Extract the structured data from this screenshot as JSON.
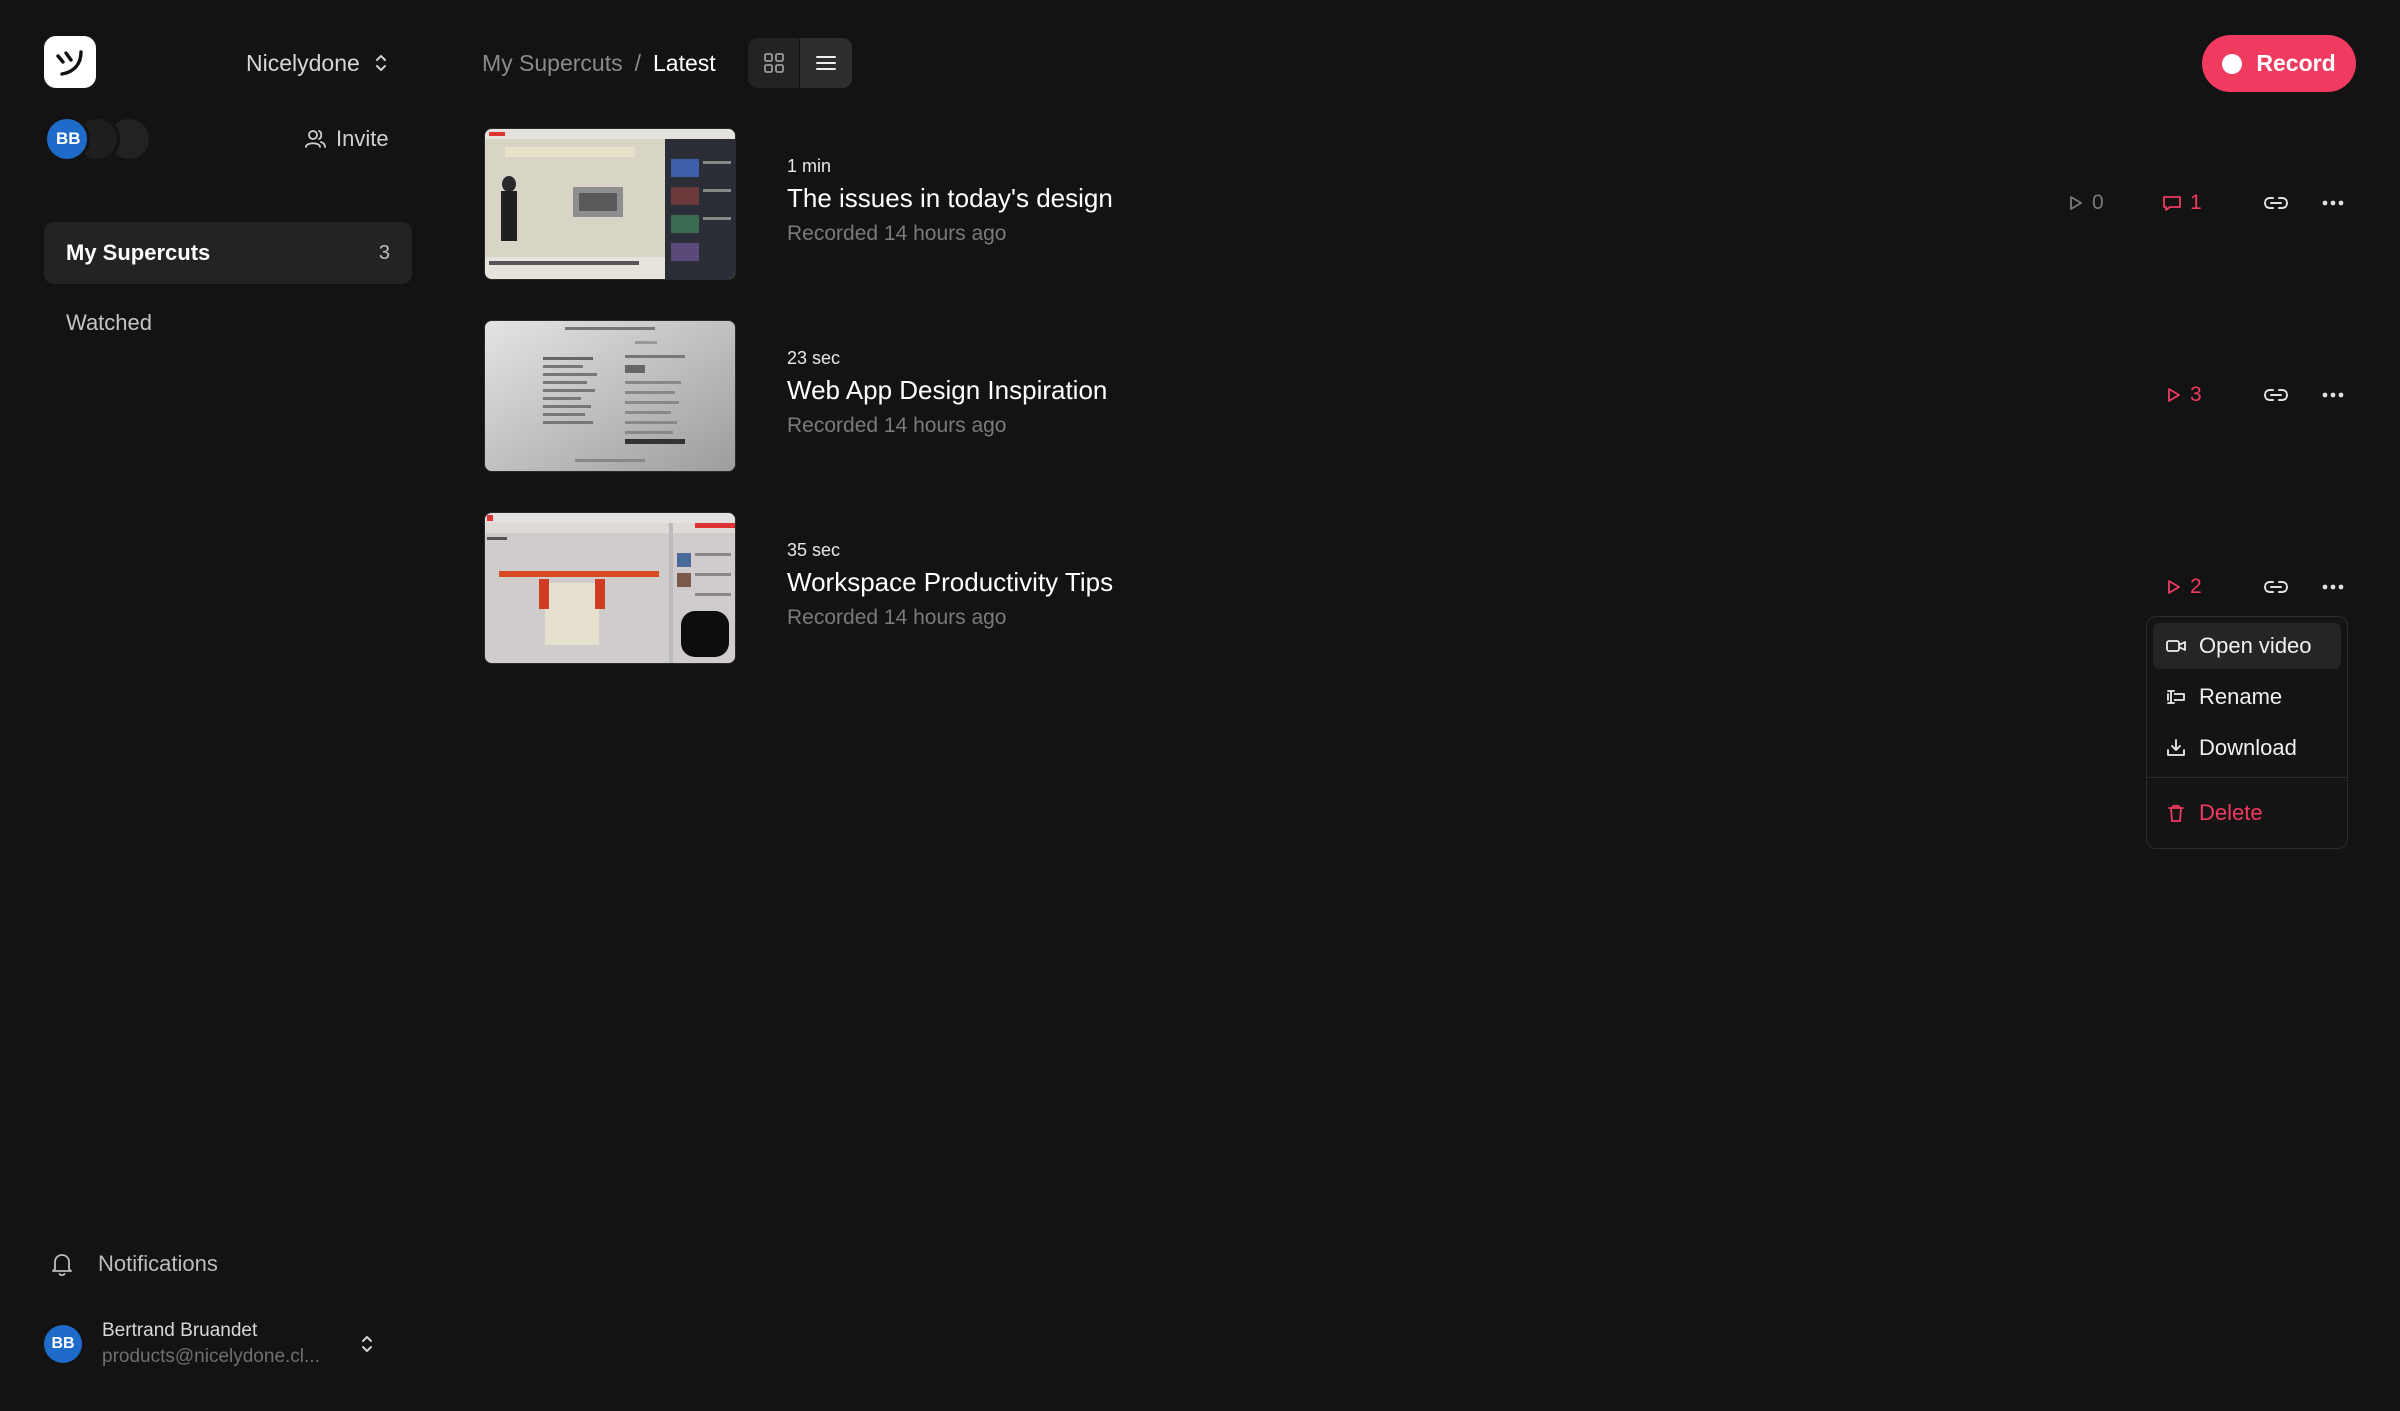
{
  "workspace": {
    "name": "Nicelydone"
  },
  "sidebar": {
    "avatar_initials": "BB",
    "invite_label": "Invite",
    "nav": [
      {
        "label": "My Supercuts",
        "count": "3"
      },
      {
        "label": "Watched"
      }
    ],
    "notifications_label": "Notifications",
    "user": {
      "name": "Bertrand Bruandet",
      "email": "products@nicelydone.cl...",
      "initials": "BB"
    }
  },
  "header": {
    "breadcrumb_parent": "My Supercuts",
    "breadcrumb_separator": "/",
    "breadcrumb_current": "Latest",
    "record_label": "Record"
  },
  "videos": [
    {
      "duration": "1 min",
      "title": "The issues in today's design",
      "recorded": "Recorded 14 hours ago",
      "views": "0",
      "comments": "1"
    },
    {
      "duration": "23 sec",
      "title": "Web App Design Inspiration",
      "recorded": "Recorded 14 hours ago",
      "views": "3"
    },
    {
      "duration": "35 sec",
      "title": "Workspace Productivity Tips",
      "recorded": "Recorded 14 hours ago",
      "views": "2"
    }
  ],
  "menu": {
    "items": [
      "Open video",
      "Rename",
      "Download"
    ],
    "delete_label": "Delete"
  },
  "colors": {
    "accent": "#f03a5f",
    "background": "#131313",
    "avatar": "#1f6bc9"
  }
}
